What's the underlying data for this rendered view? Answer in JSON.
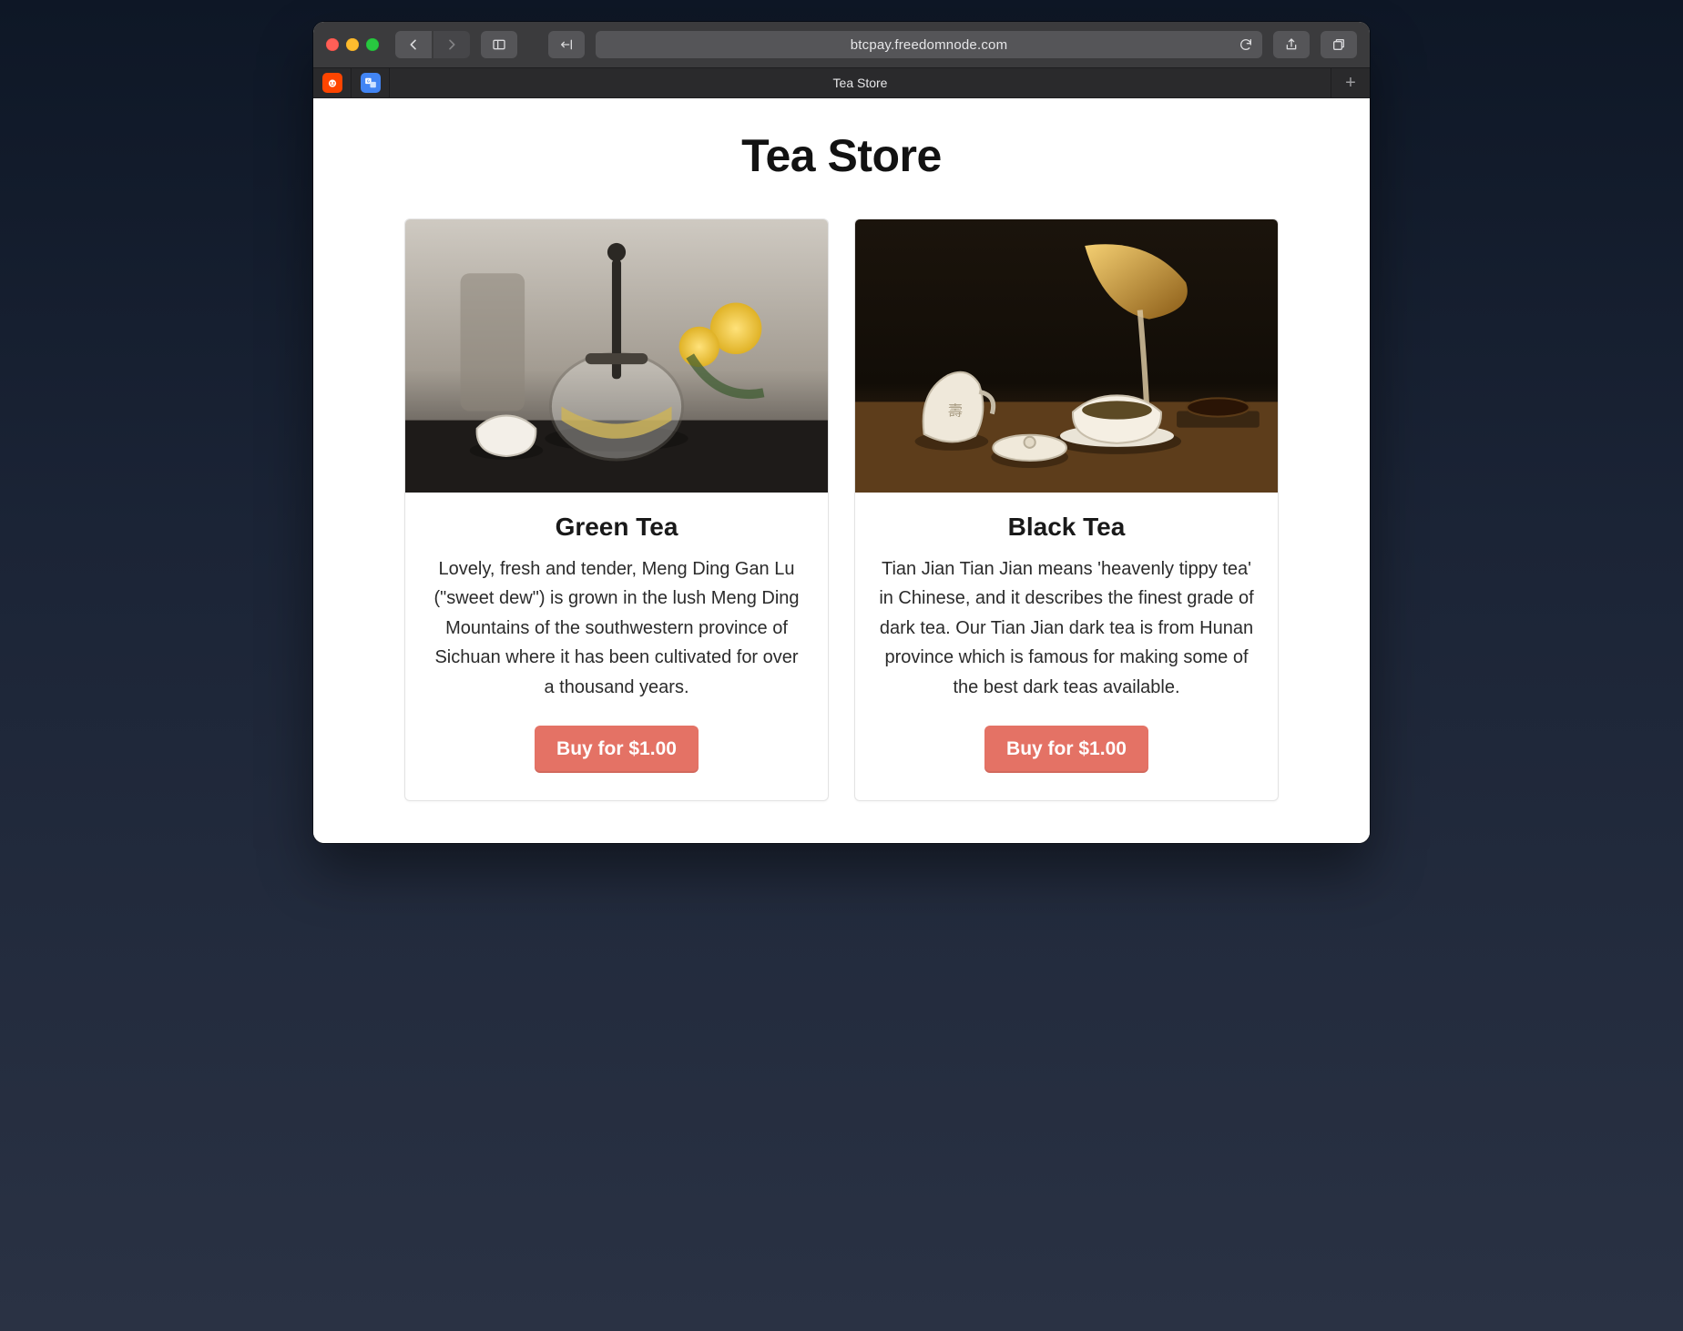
{
  "browser": {
    "url": "btcpay.freedomnode.com",
    "tab_title": "Tea Store"
  },
  "store": {
    "title": "Tea Store",
    "products": [
      {
        "name": "Green Tea",
        "description": "Lovely, fresh and tender, Meng Ding Gan Lu (\"sweet dew\") is grown in the lush Meng Ding Mountains of the southwestern province of Sichuan where it has been cultivated for over a thousand years.",
        "buy_label": "Buy for $1.00"
      },
      {
        "name": "Black Tea",
        "description": "Tian Jian Tian Jian means 'heavenly tippy tea' in Chinese, and it describes the finest grade of dark tea. Our Tian Jian dark tea is from Hunan province which is famous for making some of the best dark teas available.",
        "buy_label": "Buy for $1.00"
      }
    ]
  }
}
